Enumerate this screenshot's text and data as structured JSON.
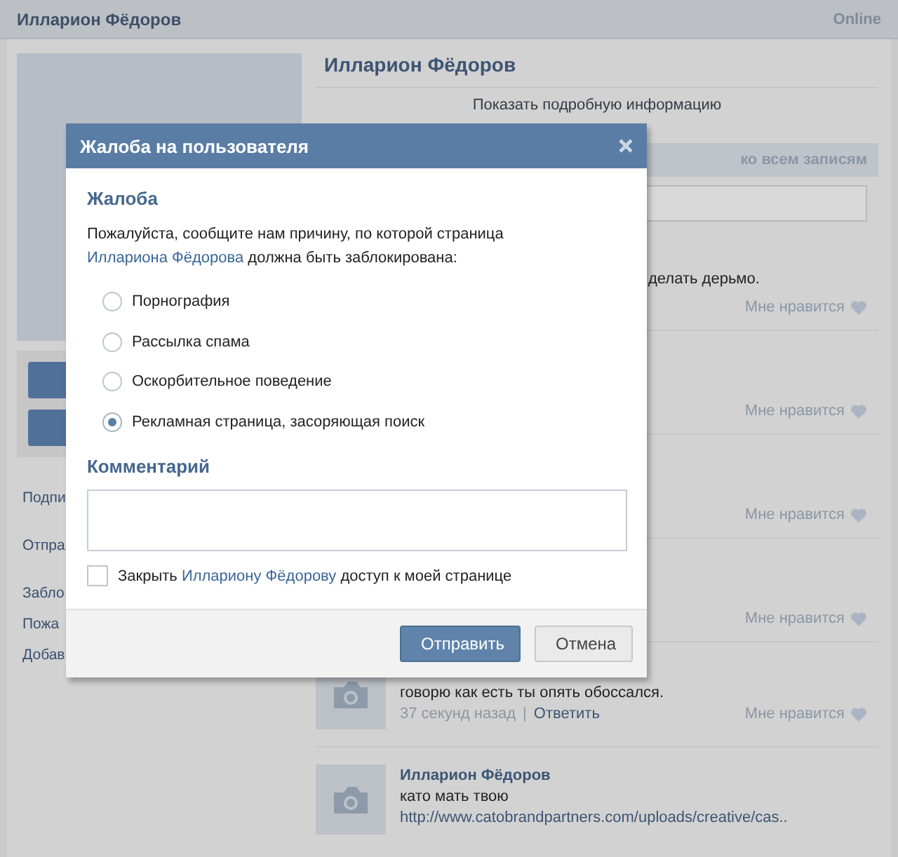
{
  "header": {
    "title": "Илларион Фёдоров",
    "status": "Online"
  },
  "sidebar": {
    "links": [
      "Подпи",
      "Отпра",
      "Забло",
      "Пожа",
      "Добав"
    ]
  },
  "profile": {
    "name": "Илларион Фёдоров",
    "details_link": "Показать подробную информацию"
  },
  "wall": {
    "header_link": "ко всем записям",
    "posts": [
      {
        "kind": "covered",
        "text": "делать дерьмо.",
        "like": "Мне нравится"
      },
      {
        "kind": "covered",
        "like": "Мне нравится"
      },
      {
        "kind": "covered",
        "like": "Мне нравится"
      },
      {
        "kind": "covered",
        "like": "Мне нравится"
      },
      {
        "kind": "comment",
        "text": "говорю как есть ты опять обоссался.",
        "time": "37 секунд назад",
        "separator": "|",
        "reply": "Ответить",
        "like": "Мне нравится"
      },
      {
        "kind": "comment",
        "author": "Илларион Фёдоров",
        "text": "като мать твою",
        "link": "http://www.catobrandpartners.com/uploads/creative/cas.."
      }
    ]
  },
  "dialog": {
    "title": "Жалоба на пользователя",
    "section": "Жалоба",
    "prompt": {
      "before": "Пожалуйста, сообщите нам причину, по которой страница",
      "link": "Иллариона Фёдорова",
      "after": "должна быть заблокирована:"
    },
    "reasons": [
      {
        "label": "Порнография",
        "selected": false
      },
      {
        "label": "Рассылка спама",
        "selected": false
      },
      {
        "label": "Оскорбительное поведение",
        "selected": false
      },
      {
        "label": "Рекламная страница, засоряющая поиск",
        "selected": true
      }
    ],
    "comment_heading": "Комментарий",
    "block": {
      "checked": false,
      "before": "Закрыть",
      "link": "Иллариону Фёдорову",
      "after": "доступ к моей странице"
    },
    "buttons": [
      {
        "label": "Отправить",
        "kind": "primary"
      },
      {
        "label": "Отмена",
        "kind": "secondary"
      }
    ]
  }
}
